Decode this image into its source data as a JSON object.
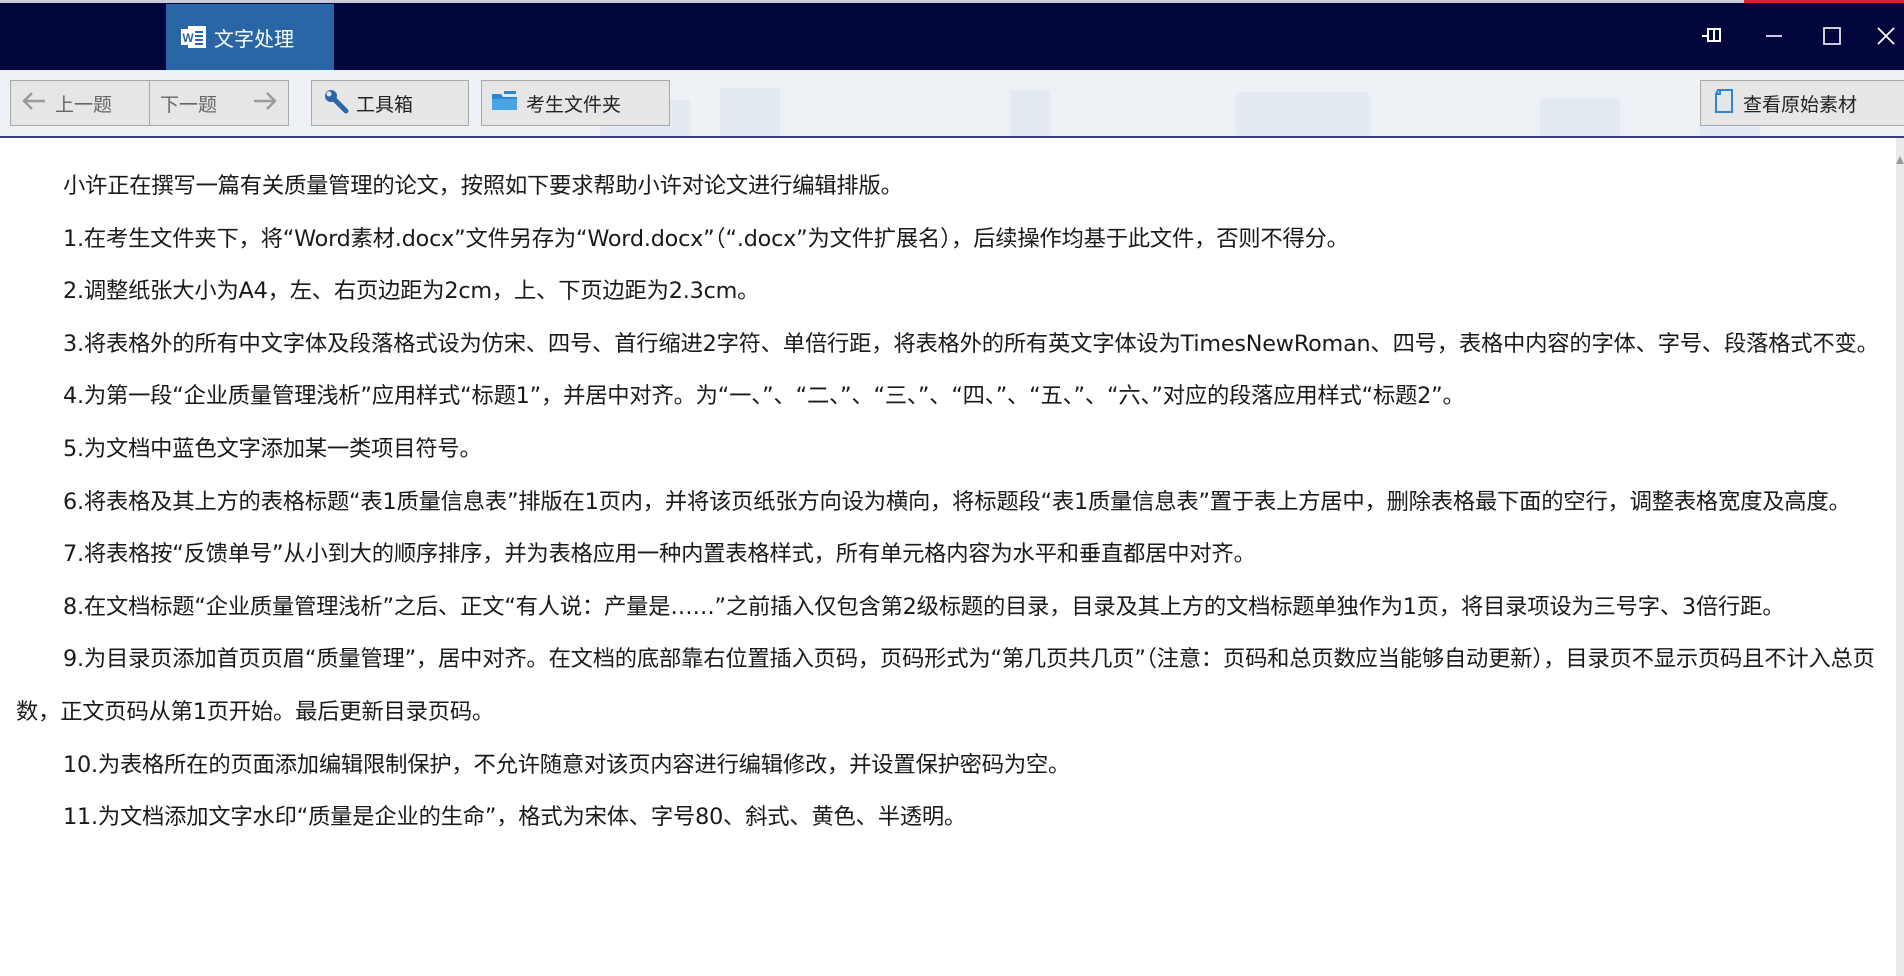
{
  "window": {
    "app_title": "文字处理",
    "colors": {
      "titlebar": "#02063d",
      "app_tab": "#2a66a5",
      "accent_red": "#d8232a"
    }
  },
  "toolbar": {
    "prev_label": "上一题",
    "next_label": "下一题",
    "toolbox_label": "工具箱",
    "folder_label": "考生文件夹",
    "view_material_label": "查看原始素材"
  },
  "document": {
    "paragraphs": [
      "小许正在撰写一篇有关质量管理的论文，按照如下要求帮助小许对论文进行编辑排版。",
      "1.在考生文件夹下，将“Word素材.docx”文件另存为“Word.docx”（“.docx”为文件扩展名），后续操作均基于此文件，否则不得分。",
      "2.调整纸张大小为A4，左、右页边距为2cm，上、下页边距为2.3cm。",
      "3.将表格外的所有中文字体及段落格式设为仿宋、四号、首行缩进2字符、单倍行距，将表格外的所有英文字体设为TimesNewRoman、四号，表格中内容的字体、字号、段落格式不变。",
      "4.为第一段“企业质量管理浅析”应用样式“标题1”，并居中对齐。为“一、”、“二、”、“三、”、“四、”、“五、”、“六、”对应的段落应用样式“标题2”。",
      "5.为文档中蓝色文字添加某一类项目符号。",
      "6.将表格及其上方的表格标题“表1质量信息表”排版在1页内，并将该页纸张方向设为横向，将标题段“表1质量信息表”置于表上方居中，删除表格最下面的空行，调整表格宽度及高度。",
      "7.将表格按“反馈单号”从小到大的顺序排序，并为表格应用一种内置表格样式，所有单元格内容为水平和垂直都居中对齐。",
      "8.在文档标题“企业质量管理浅析”之后、正文“有人说：产量是……”之前插入仅包含第2级标题的目录，目录及其上方的文档标题单独作为1页，将目录项设为三号字、3倍行距。",
      "9.为目录页添加首页页眉“质量管理”，居中对齐。在文档的底部靠右位置插入页码，页码形式为“第几页共几页”（注意：页码和总页数应当能够自动更新），目录页不显示页码且不计入总页数，正文页码从第1页开始。最后更新目录页码。",
      "10.为表格所在的页面添加编辑限制保护，不允许随意对该页内容进行编辑修改，并设置保护密码为空。",
      "11.为文档添加文字水印“质量是企业的生命”，格式为宋体、字号80、斜式、黄色、半透明。"
    ]
  }
}
